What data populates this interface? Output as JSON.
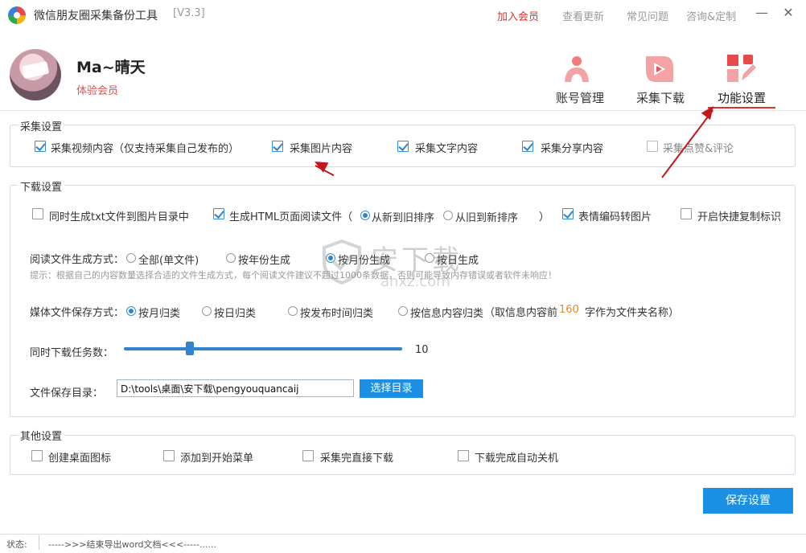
{
  "titlebar": {
    "title": "微信朋友圈采集备份工具",
    "version": "[V3.3]",
    "nav": [
      "加入会员",
      "查看更新",
      "常见问题",
      "咨询&定制"
    ],
    "minimize": "—",
    "close": "✕"
  },
  "profile": {
    "username": "Ma~晴天",
    "level": "体验会员"
  },
  "tabs": [
    {
      "label": "账号管理",
      "icon": "person-icon"
    },
    {
      "label": "采集下载",
      "icon": "play-leaf-icon"
    },
    {
      "label": "功能设置",
      "icon": "settings-pencil-icon",
      "active": true
    }
  ],
  "collect": {
    "legend": "采集设置",
    "options": [
      {
        "label": "采集视频内容（仅支持采集自己发布的）",
        "checked": true
      },
      {
        "label": "采集图片内容",
        "checked": true
      },
      {
        "label": "采集文字内容",
        "checked": true
      },
      {
        "label": "采集分享内容",
        "checked": true
      },
      {
        "label": "采集点赞&评论",
        "checked": false
      }
    ]
  },
  "download": {
    "legend": "下载设置",
    "txt_option": "同时生成txt文件到图片目录中",
    "html_option": "生成HTML页面阅读文件（",
    "sort_new_old": "从新到旧排序",
    "sort_old_new": "从旧到新排序",
    "paren_close": "）",
    "emoji_option": "表情编码转图片",
    "quick_copy_option": "开启快捷复制标识",
    "read_mode_label": "阅读文件生成方式：",
    "read_modes": [
      "全部(单文件)",
      "按年份生成",
      "按月份生成",
      "按日生成"
    ],
    "read_mode_selected": 2,
    "hint": "提示：根据自己的内容数量选择合适的文件生成方式，每个阅读文件建议不超过1000条数据，否则可能导致内存错误或者软件未响应！",
    "media_label": "媒体文件保存方式：",
    "media_modes": [
      "按月归类",
      "按日归类",
      "按发布时间归类",
      "按信息内容归类"
    ],
    "media_mode_selected": 0,
    "media_suffix_a": "（取信息内容前",
    "media_suffix_num": "160",
    "media_suffix_b": "字作为文件夹名称）",
    "tasks_label": "同时下载任务数：",
    "tasks_value": "10",
    "tasks_fraction": 0.23,
    "dir_label": "文件保存目录：",
    "dir_value": "D:\\tools\\桌面\\安下载\\pengyouquancaij",
    "dir_button": "选择目录"
  },
  "other": {
    "legend": "其他设置",
    "options": [
      {
        "label": "创建桌面图标",
        "checked": false
      },
      {
        "label": "添加到开始菜单",
        "checked": false
      },
      {
        "label": "采集完直接下载",
        "checked": false
      },
      {
        "label": "下载完成自动关机",
        "checked": false
      }
    ]
  },
  "save_button": "保存设置",
  "watermark": {
    "text": "安下载",
    "sub": "anxz.com"
  },
  "status": {
    "label": "状态:",
    "text": "----->>>结束导出word文档<<<-----......"
  },
  "colors": {
    "accent": "#1a8fe3",
    "vip": "#e0302a",
    "orange": "#e8891a"
  }
}
